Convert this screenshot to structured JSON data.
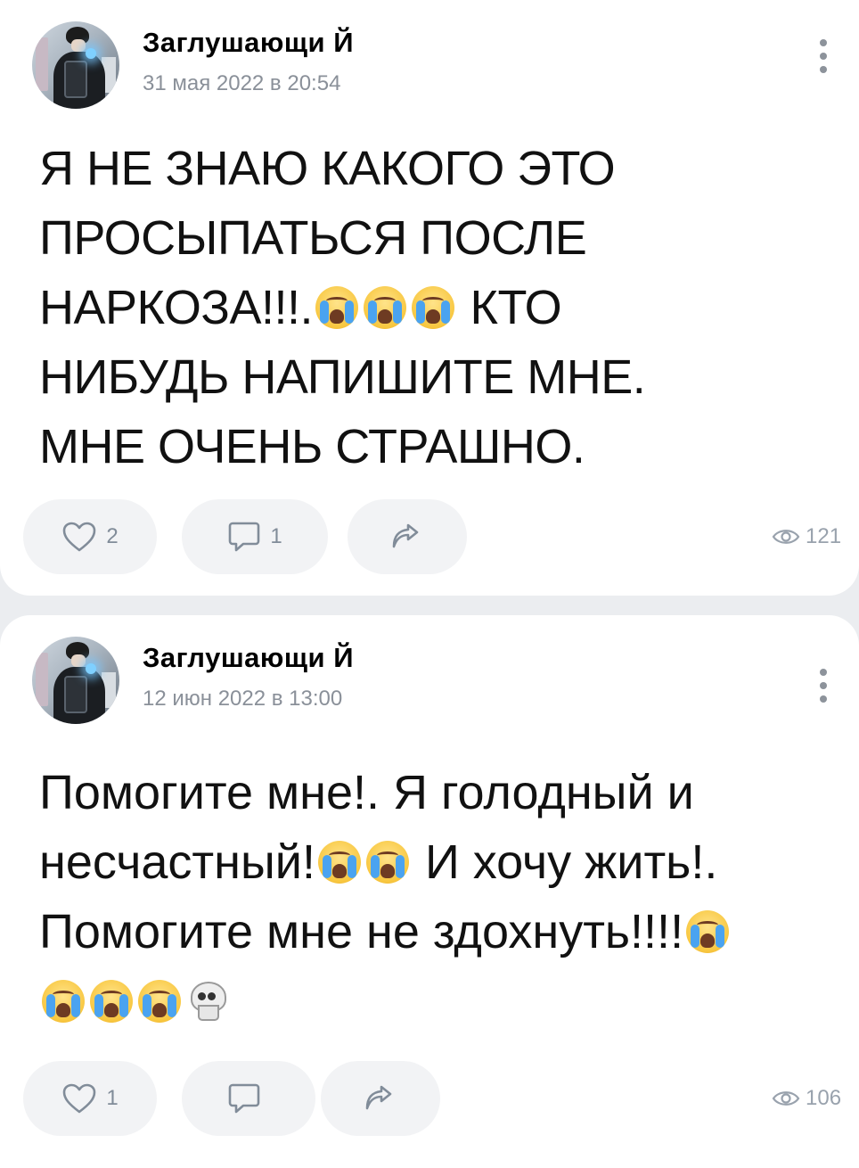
{
  "posts": [
    {
      "author": "Заглушающи Й",
      "date": "31 мая 2022 в 20:54",
      "text_lines": [
        "Я НЕ ЗНАЮ КАКОГО ЭТО",
        "ПРОСЫПАТЬСЯ ПОСЛЕ",
        "НАРКОЗА!!!.",
        "КТО",
        "НИБУДЬ НАПИШИТЕ МНЕ.",
        "МНЕ ОЧЕНЬ СТРАШНО."
      ],
      "likes": "2",
      "comments": "1",
      "views": "121"
    },
    {
      "author": "Заглушающи Й",
      "date": "12 июн 2022 в 13:00",
      "text_lines": [
        "Помогите мне!. Я голодный и",
        "несчастный!",
        "И хочу жить!.",
        "Помогите мне не здохнуть!!!!"
      ],
      "likes": "1",
      "comments": "",
      "views": "106"
    }
  ],
  "icons": {
    "like": "heart-icon",
    "comment": "comment-icon",
    "share": "share-icon",
    "views": "eye-icon",
    "menu": "more-vertical-icon",
    "emoji_cry": "loudly-crying-face-emoji",
    "emoji_skull": "skull-emoji"
  },
  "colors": {
    "background": "#ebedf0",
    "card": "#ffffff",
    "pill": "#f2f3f5",
    "secondary_text": "#8a9099"
  }
}
